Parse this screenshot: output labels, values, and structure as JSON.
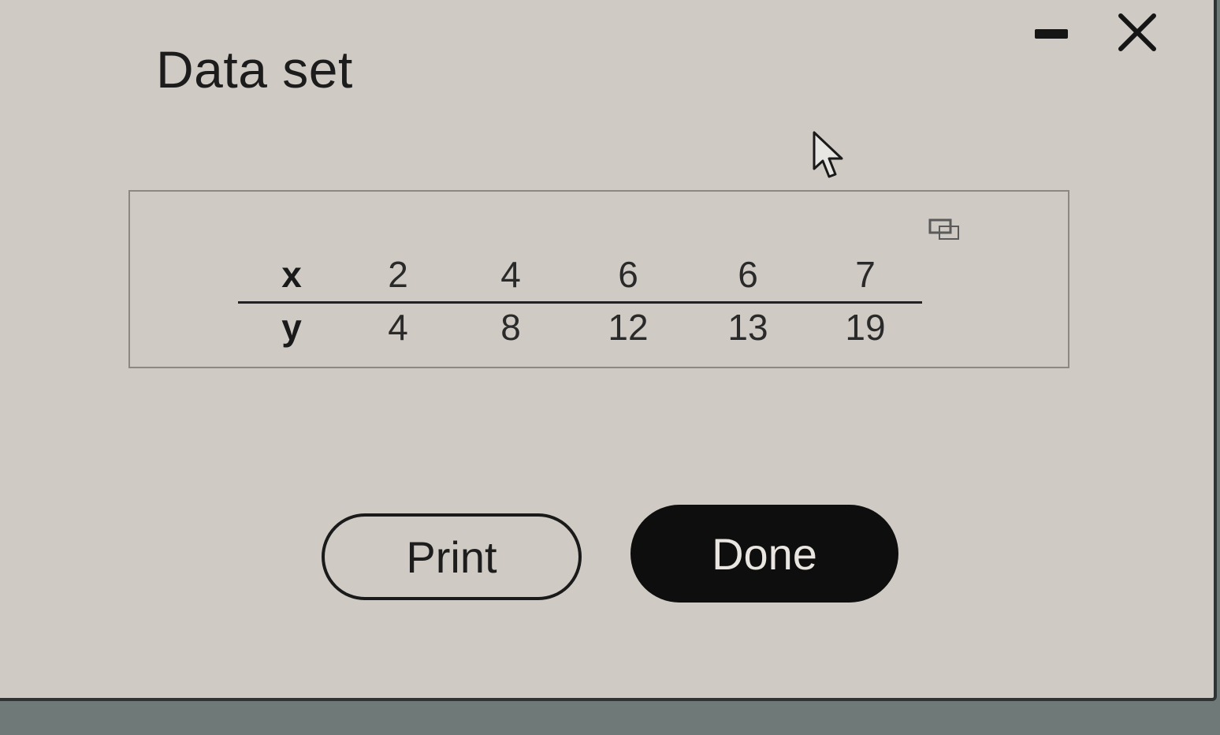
{
  "dialog": {
    "title": "Data set"
  },
  "window_controls": {
    "minimize_icon": "minimize-icon",
    "close_icon": "close-icon"
  },
  "table": {
    "header_x": "x",
    "header_y": "y",
    "x_values": [
      "2",
      "4",
      "6",
      "6",
      "7"
    ],
    "y_values": [
      "4",
      "8",
      "12",
      "13",
      "19"
    ],
    "copy_icon": "copy-icon"
  },
  "buttons": {
    "print_label": "Print",
    "done_label": "Done"
  },
  "colors": {
    "dialog_background": "#cfcac3",
    "done_button": "#0e0e0e",
    "text": "#1c1c1c"
  }
}
